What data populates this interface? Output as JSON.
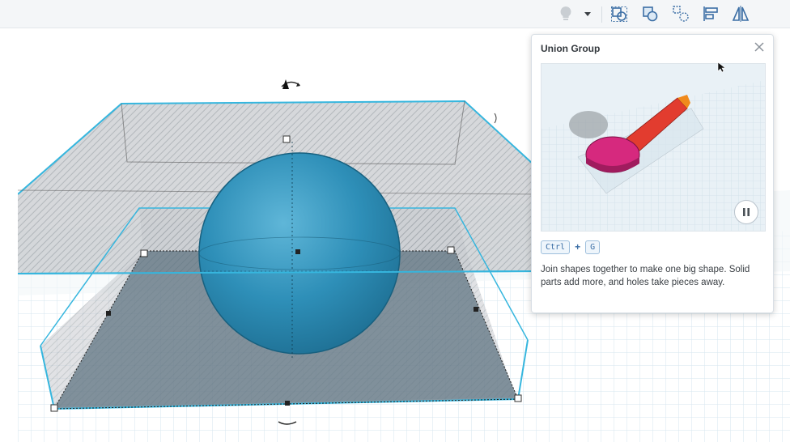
{
  "toolbar": {
    "buttons": [
      {
        "name": "light-bulb-icon"
      },
      {
        "name": "dropdown-caret-icon"
      },
      {
        "name": "group-icon"
      },
      {
        "name": "union-group-icon"
      },
      {
        "name": "ungroup-icon"
      },
      {
        "name": "align-icon"
      },
      {
        "name": "mirror-icon"
      }
    ]
  },
  "tooltip": {
    "title": "Union Group",
    "shortcut_key1": "Ctrl",
    "shortcut_plus": "+",
    "shortcut_key2": "G",
    "description": "Join shapes together to make one big shape. Solid parts add more, and holes take pieces away.",
    "pause_icon": "pause-icon",
    "close_icon": "close-icon"
  },
  "colors": {
    "sphere": "#2e8fb8",
    "selection_outline": "#36b6de",
    "hole_fill": "#9aa0a6",
    "workplane_grid": "#cfe3ee",
    "spoon_pink": "#d6297e",
    "spoon_red": "#e23c2f"
  }
}
